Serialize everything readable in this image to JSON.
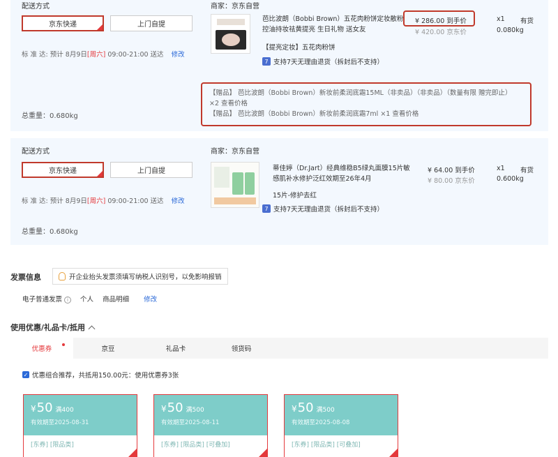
{
  "order1": {
    "ship_label": "配送方式",
    "ship_option_jd": "京东快递",
    "ship_option_pickup": "上门自提",
    "std_label": "标 准 达:",
    "eta_prefix": "预计 8月9日",
    "eta_weekday": "[周六]",
    "eta_time": "09:00-21:00 送达",
    "modify": "修改",
    "total_weight": "总重量：0.680kg",
    "merchant": "商家：京东自营",
    "product_name": "芭比波朗（Bobbi Brown）五花肉粉饼定妆散粉控油持妆祛黄提亮 生日礼物 送女友",
    "price": "¥ 286.00 到手价",
    "orig_price": "¥ 420.00 京东价",
    "qty": "x1",
    "stock": "有货",
    "weight": "0.080kg",
    "spec": "【提亮定妆】五花肉粉饼",
    "return_icon": "7",
    "return_policy": "支持7天无理由退货（拆封后不支持）",
    "gift_line1": "【赠品】  芭比波朗（Bobbi Brown）新妆前柔润底霜15ML（非卖品）（非卖品）（数量有限 赠完即止）",
    "gift_line2": "×2  查看价格",
    "gift_line3": "【赠品】  芭比波朗（Bobbi Brown）新妆前柔润底霜7ml ×1  查看价格"
  },
  "order2": {
    "ship_label": "配送方式",
    "ship_option_jd": "京东快递",
    "ship_option_pickup": "上门自提",
    "std_label": "标 准 达:",
    "eta_prefix": "预计 8月9日",
    "eta_weekday": "[周六]",
    "eta_time": "09:00-21:00 送达",
    "modify": "修改",
    "total_weight": "总重量：0.680kg",
    "merchant": "商家：京东自营",
    "product_name": "蒂佳婷（Dr.Jart）经典维稳B5绿丸面膜15片敏感肌补水修护泛红效期至26年4月",
    "price": "¥ 64.00 到手价",
    "orig_price": "¥ 80.00 京东价",
    "qty": "x1",
    "stock": "有货",
    "weight": "0.600kg",
    "spec": "15片-修护去红",
    "return_icon": "7",
    "return_policy": "支持7天无理由退货（拆封后不支持）"
  },
  "invoice": {
    "title": "发票信息",
    "tip": "开企业抬头发票须填写纳税人识别号，以免影响报销",
    "type": "电子普通发票",
    "info_icon": "i",
    "person": "个人",
    "detail": "商品明细",
    "modify": "修改"
  },
  "coupons": {
    "title": "使用优惠/礼品卡/抵用",
    "tabs": [
      "优惠券",
      "京豆",
      "礼品卡",
      "领货码"
    ],
    "combo_text": "优惠组合推荐，共抵用150.00元：使用优惠券3张",
    "items": [
      {
        "yen": "¥",
        "amount": "50",
        "cond": "满400",
        "expiry": "有效期至2025-08-31",
        "tags": "[东券]  [限品类]"
      },
      {
        "yen": "¥",
        "amount": "50",
        "cond": "满500",
        "expiry": "有效期至2025-08-11",
        "tags": "[东券]  [限品类]  [可叠加]"
      },
      {
        "yen": "¥",
        "amount": "50",
        "cond": "满500",
        "expiry": "有效期至2025-08-08",
        "tags": "[东券]  [限品类]  [可叠加]"
      }
    ]
  },
  "colors": {
    "accent_red": "#e4393c",
    "link_blue": "#2c6ad8",
    "coupon_teal": "#7ecdc9"
  }
}
